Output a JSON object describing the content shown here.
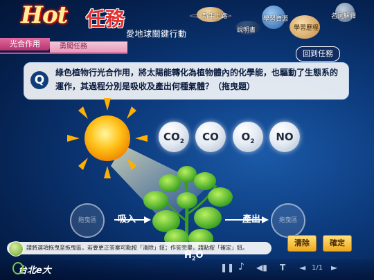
{
  "header": {
    "logo_hot": "Hot",
    "logo_task": "任務",
    "subtitle": "愛地球關鍵行動",
    "nav": [
      {
        "label": "新手上路"
      },
      {
        "label": "學習資源"
      },
      {
        "label": "名詞解釋"
      },
      {
        "label": "說明書"
      },
      {
        "label": "學習歷程"
      }
    ]
  },
  "tabs": {
    "topic": "光合作用",
    "mode": "勇闖任務"
  },
  "back_button": "回到任務",
  "question": {
    "marker": "Q",
    "text": "綠色植物行光合作用，將太陽能轉化為植物體內的化學能，也驅動了生態系的運作，其過程分別是吸收及產出何種氣體？（拖曳題）"
  },
  "options": [
    {
      "main": "CO",
      "sub": "2"
    },
    {
      "main": "CO",
      "sub": ""
    },
    {
      "main": "O",
      "sub": "2"
    },
    {
      "main": "NO",
      "sub": ""
    }
  ],
  "drop_zones": {
    "absorb_placeholder": "拖曳區",
    "absorb_label": "吸入",
    "produce_placeholder": "拖曳區",
    "produce_label": "產出"
  },
  "ground_label": {
    "main": "H",
    "sub": "2",
    "tail": "O"
  },
  "instruction": "請將選項拖曳至拖曳區，若要更正答案可點按「清除」鈕；作答完畢，請點按「確定」鈕。",
  "buttons": {
    "clear": "清除",
    "confirm": "確定"
  },
  "footer": {
    "brand": "台北e大",
    "page_indicator": "1/1",
    "controls": [
      "pause-icon",
      "music-icon",
      "volume-icon",
      "text-icon",
      "prev-icon",
      "next-icon"
    ]
  },
  "colors": {
    "accent_pink": "#d04a86",
    "button_gold": "#f0a81e",
    "question_navy": "#0f3d7a"
  }
}
